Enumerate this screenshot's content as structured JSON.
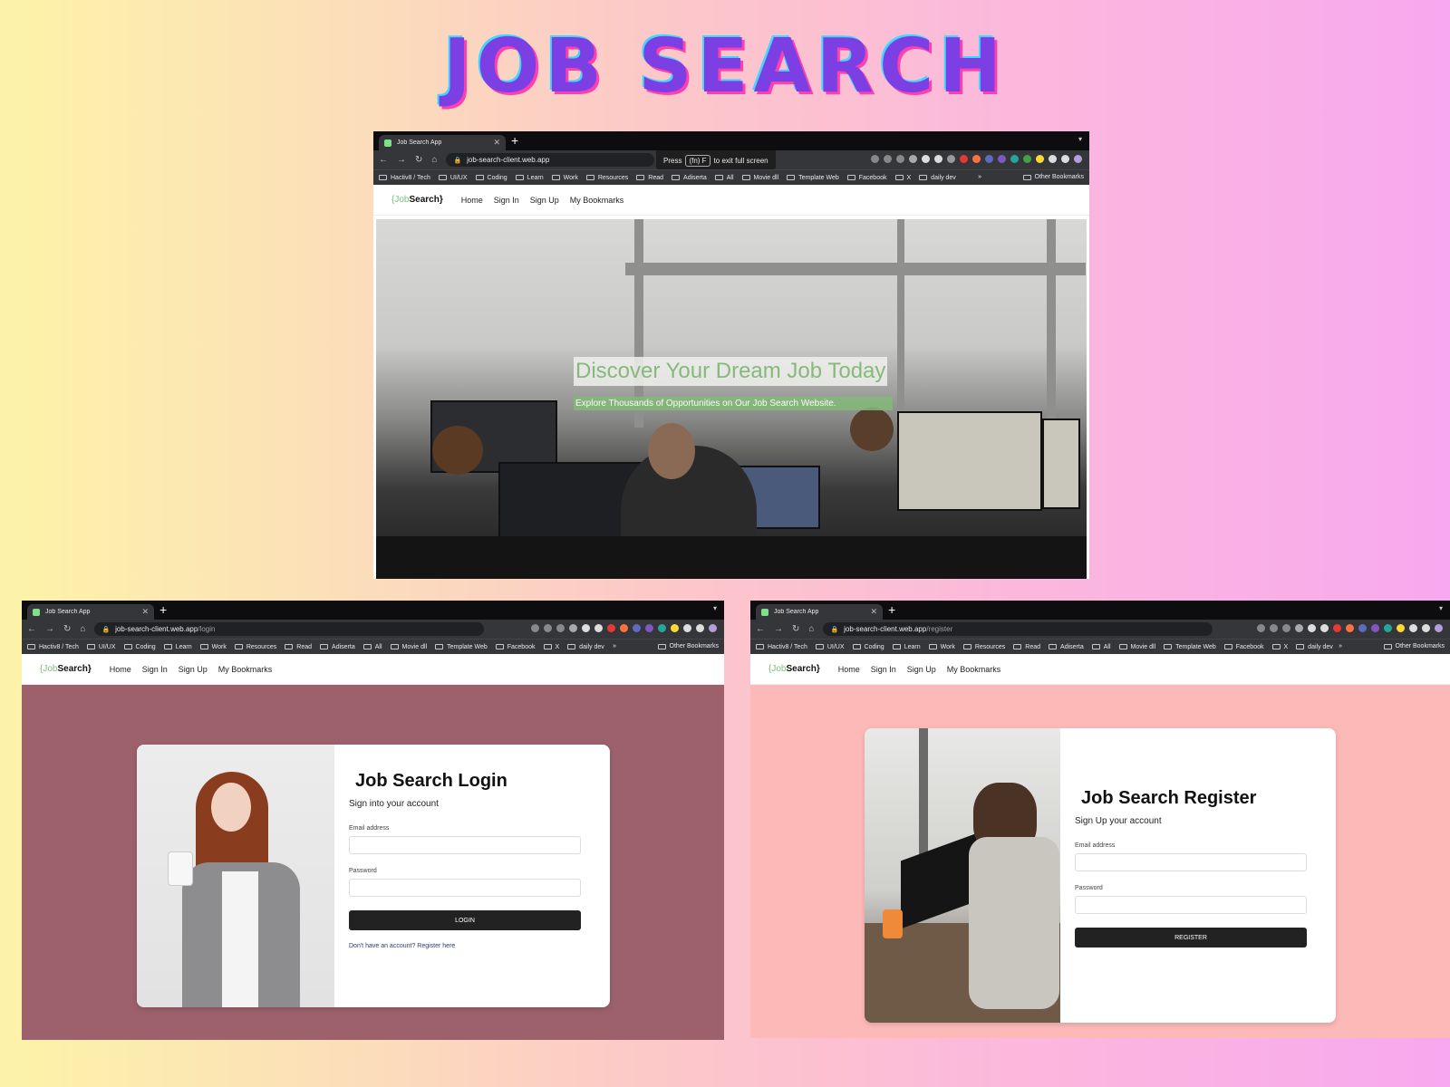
{
  "page_title": "JOB SEARCH",
  "colors": {
    "login_bg": "#9c616b",
    "register_bg": "#fdb9b8",
    "logo_accent": "#7fbf7f"
  },
  "browser": {
    "tab_title": "Job Search App",
    "new_tab": "+",
    "bookmarks": [
      "Hactiv8 / Tech",
      "UI/UX",
      "Coding",
      "Learn",
      "Work",
      "Resources",
      "Read",
      "Adiserta",
      "All",
      "Movie dll",
      "Template Web",
      "Facebook",
      "X",
      "daily dev"
    ],
    "more": "»",
    "other_bookmarks": "Other Bookmarks"
  },
  "site_nav": {
    "logo_prefix": "{Job",
    "logo_main": "Search}",
    "links": [
      "Home",
      "Sign In",
      "Sign Up",
      "My Bookmarks"
    ]
  },
  "home": {
    "url": "job-search-client.web.app",
    "fullscreen_hint": {
      "press": "Press",
      "key": "(fn) F",
      "rest": "to exit full screen"
    },
    "hero_title": "Discover Your Dream Job Today",
    "hero_subtitle": "Explore Thousands of Opportunities on Our Job Search Website."
  },
  "login": {
    "url_host": "job-search-client.web.app",
    "url_path": "/login",
    "title": "Job Search Login",
    "subtitle": "Sign into your account",
    "email_label": "Email address",
    "password_label": "Password",
    "button": "LOGIN",
    "register_link": "Don't have an account? Register here"
  },
  "register": {
    "url_host": "job-search-client.web.app",
    "url_path": "/register",
    "title": "Job Search Register",
    "subtitle": "Sign Up your account",
    "email_label": "Email address",
    "password_label": "Password",
    "button": "REGISTER"
  }
}
